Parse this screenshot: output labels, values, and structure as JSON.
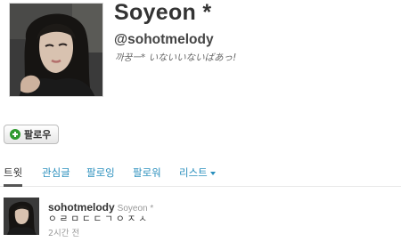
{
  "profile": {
    "name": "Soyeon *",
    "handle": "@sohotmelody",
    "bio": "까꿍ㅡ* いないいないばあっ!"
  },
  "actions": {
    "follow_label": "팔로우",
    "follow_icon": "plus-circle-icon"
  },
  "tabs": [
    {
      "label": "트윗",
      "active": true
    },
    {
      "label": "관심글",
      "active": false
    },
    {
      "label": "팔로잉",
      "active": false
    },
    {
      "label": "팔로워",
      "active": false
    },
    {
      "label": "리스트",
      "active": false,
      "has_dropdown": true
    }
  ],
  "tweet": {
    "username": "sohotmelody",
    "fullname": "Soyeon *",
    "text": "ㅇㄹㅁㄷㄷㄱㅇㅈㅅ",
    "time": "2시간 전"
  },
  "colors": {
    "link": "#2a8fbd",
    "text": "#333333",
    "muted": "#999999",
    "follow_icon": "#2e9a2e"
  }
}
